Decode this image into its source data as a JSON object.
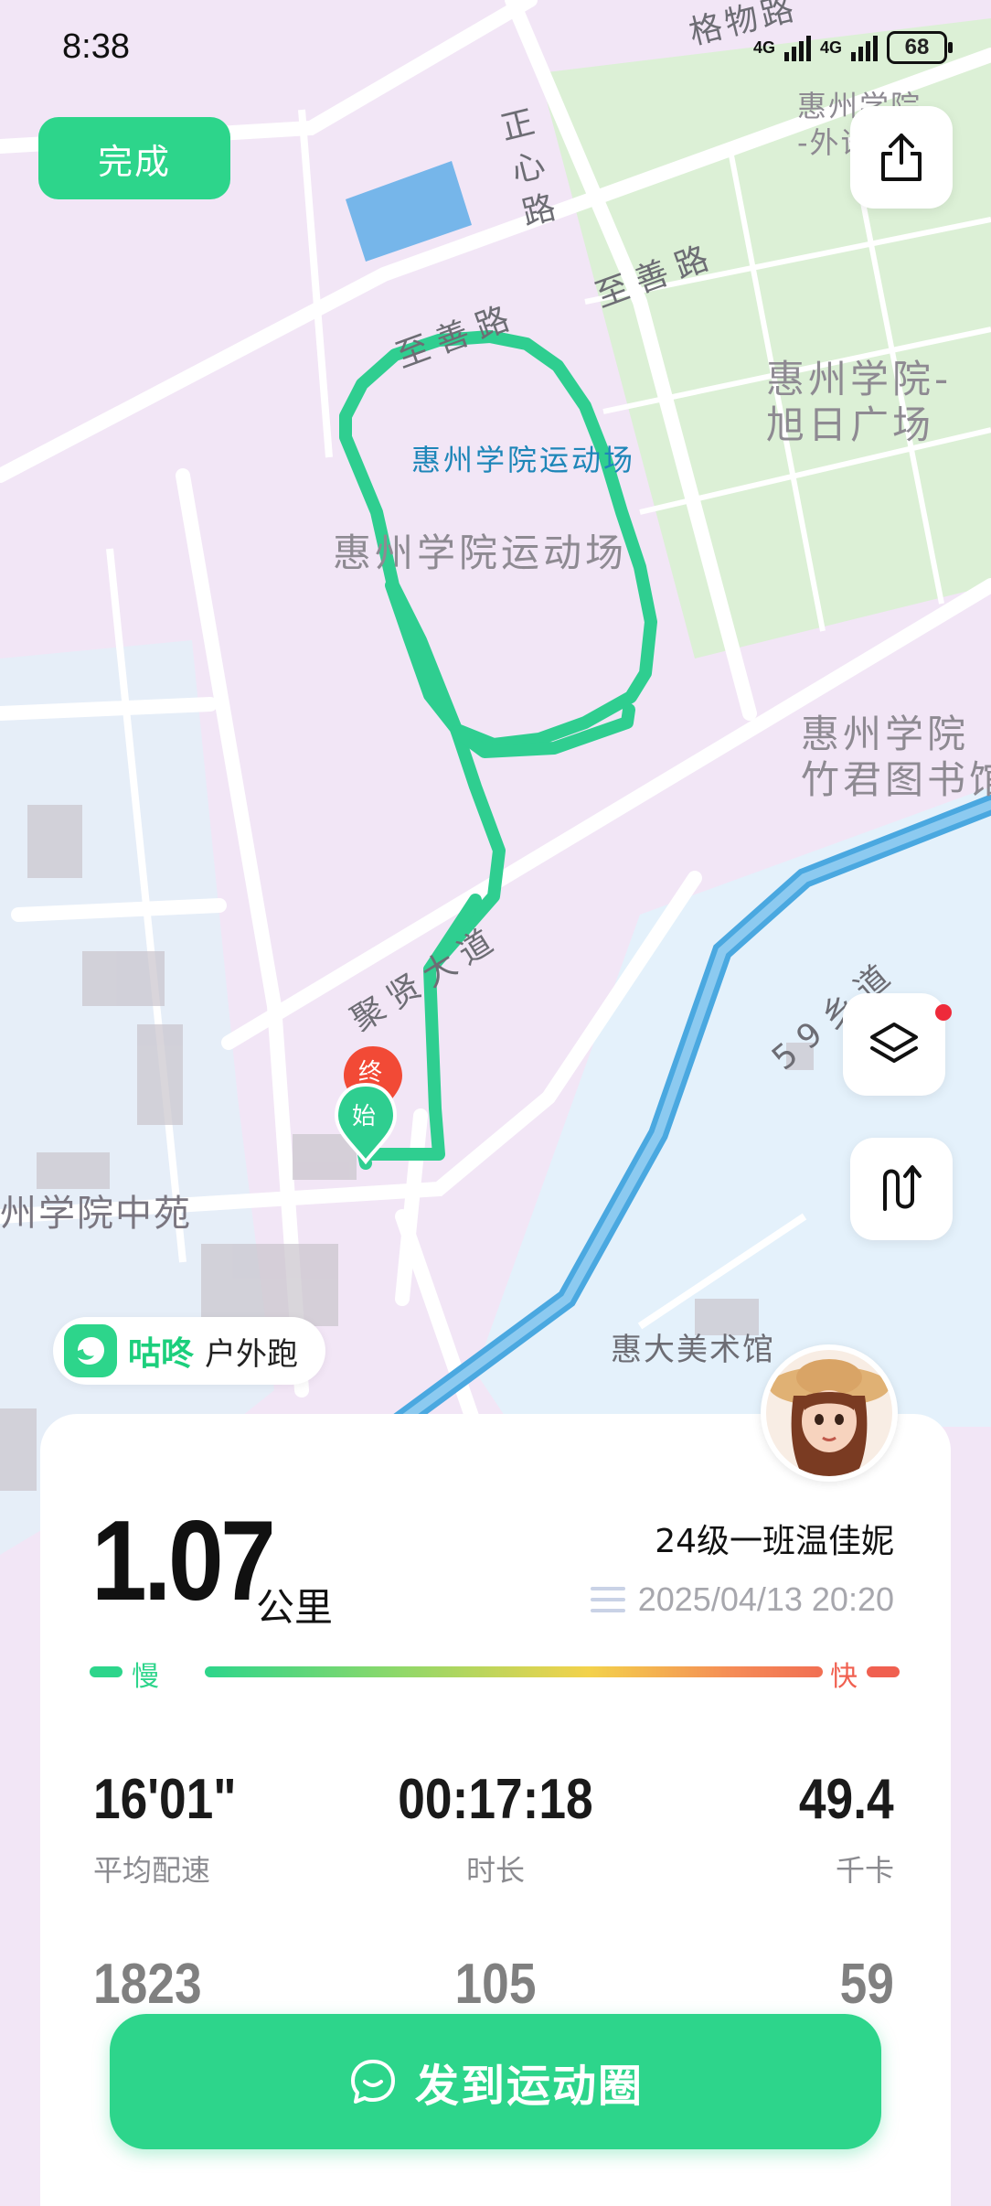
{
  "status_bar": {
    "time": "8:38",
    "network_1": "4G",
    "network_2": "4G",
    "battery": "68"
  },
  "toolbar": {
    "done_label": "完成"
  },
  "map": {
    "labels": {
      "road_gewu": "格物路",
      "school_waiyu": "惠州学院\n-外语",
      "road_zhengxin": "正心路",
      "road_zhishan_1": "至善路",
      "road_zhishan_2": "至善路",
      "xuri_square": "惠州学院-\n旭日广场",
      "stadium_blue": "惠州学院运动场",
      "stadium_gray": "惠州学院运动场",
      "library": "惠州学院\n竹君图书馆",
      "road_juxian": "聚贤大道",
      "road_59": "59乡道",
      "zhongyuan": "州学院中苑",
      "art_museum": "惠大美术馆"
    },
    "marker_end": "终",
    "marker_start": "始",
    "route_color": "#2fce90"
  },
  "app_badge": {
    "app_name": "咕咚",
    "mode": "户外跑"
  },
  "summary": {
    "distance": "1.07",
    "distance_unit": "公里",
    "user_name": "24级一班温佳妮",
    "datetime": "2025/04/13 20:20",
    "pace_slow": "慢",
    "pace_fast": "快"
  },
  "stats": {
    "avg_pace": {
      "value": "16'01\"",
      "label": "平均配速"
    },
    "duration": {
      "value": "00:17:18",
      "label": "时长"
    },
    "calories": {
      "value": "49.4",
      "label": "千卡"
    },
    "row2_left": {
      "value": "1823"
    },
    "row2_center": {
      "value": "105"
    },
    "row2_right": {
      "value": "59"
    }
  },
  "post_button": {
    "label": "发到运动圈"
  },
  "colors": {
    "accent": "#2dd58b",
    "fast": "#f06050",
    "map_bg": "#f2e6f6",
    "water": "#4aa8e0"
  }
}
